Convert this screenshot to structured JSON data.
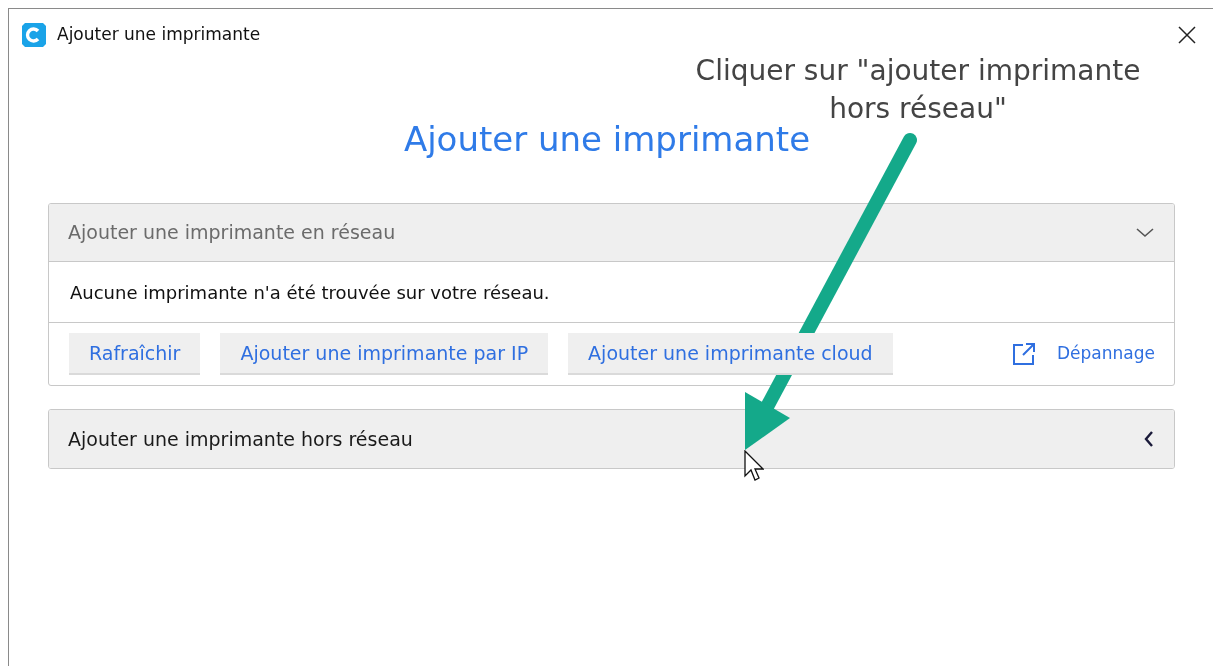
{
  "window": {
    "title": "Ajouter une imprimante"
  },
  "heading": "Ajouter une imprimante",
  "sections": [
    {
      "title": "Ajouter une imprimante en réseau",
      "expanded": true,
      "message": "Aucune imprimante n'a été trouvée sur votre réseau.",
      "buttons": [
        "Rafraîchir",
        "Ajouter une imprimante par IP",
        "Ajouter une imprimante cloud"
      ],
      "link": "Dépannage"
    },
    {
      "title": "Ajouter une imprimante hors réseau",
      "expanded": false
    }
  ],
  "annotation": {
    "text": "Cliquer sur \"ajouter imprimante hors réseau\""
  }
}
